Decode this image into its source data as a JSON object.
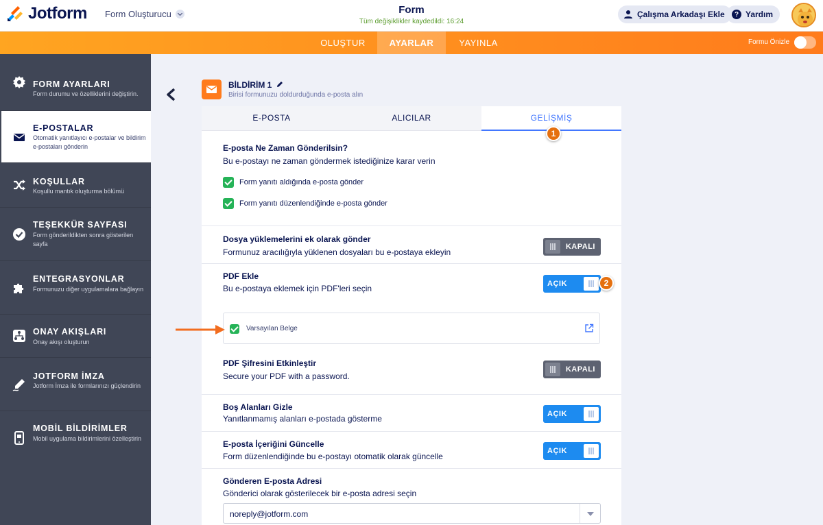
{
  "app": {
    "brand": "Jotform",
    "builder_label": "Form Oluşturucu",
    "form_title": "Form",
    "save_status": "Tüm değişiklikler kaydedildi: 16:24",
    "invite_label": "Çalışma Arkadaşı Ekle",
    "help_label": "Yardım"
  },
  "nav": {
    "tabs": [
      {
        "label": "OLUŞTUR"
      },
      {
        "label": "AYARLAR"
      },
      {
        "label": "YAYINLA"
      }
    ],
    "preview_label": "Formu Önizle"
  },
  "sidebar": {
    "items": [
      {
        "title": "FORM AYARLARI",
        "desc": "Form durumu ve özelliklerini değiştirin."
      },
      {
        "title": "E-POSTALAR",
        "desc": "Otomatik yanıtlayıcı e-postalar ve bildirim e-postaları gönderin"
      },
      {
        "title": "KOŞULLAR",
        "desc": "Koşullu mantık oluşturma bölümü"
      },
      {
        "title": "TEŞEKKÜR SAYFASI",
        "desc": "Form gönderildikten sonra gösterilen sayfa"
      },
      {
        "title": "ENTEGRASYONLAR",
        "desc": "Formunuzu diğer uygulamalara bağlayın"
      },
      {
        "title": "ONAY AKIŞLARI",
        "desc": "Onay akışı oluşturun"
      },
      {
        "title": "JOTFORM İMZA",
        "desc": "Jotform İmza ile formlarınızı güçlendirin"
      },
      {
        "title": "MOBİL BİLDİRİMLER",
        "desc": "Mobil uygulama bildirimlerini özelleştirin"
      }
    ]
  },
  "notification": {
    "title": "BİLDİRİM 1",
    "subtitle": "Birisi formunuzu doldurduğunda e-posta alın"
  },
  "tabs": [
    {
      "label": "E-POSTA"
    },
    {
      "label": "ALICILAR"
    },
    {
      "label": "GELİŞMİŞ"
    }
  ],
  "badges": {
    "one": "1",
    "two": "2"
  },
  "advanced": {
    "when": {
      "title": "E-posta Ne Zaman Gönderilsin?",
      "desc": "Bu e-postayı ne zaman göndermek istediğinize karar verin",
      "options": [
        {
          "label": "Form yanıtı aldığında e-posta gönder",
          "checked": true
        },
        {
          "label": "Form yanıtı düzenlendiğinde e-posta gönder",
          "checked": true
        }
      ]
    },
    "attachments": {
      "title": "Dosya yüklemelerini ek olarak gönder",
      "desc": "Formunuz aracılığıyla yüklenen dosyaları bu e-postaya ekleyin",
      "state": "KAPALI"
    },
    "pdf": {
      "title": "PDF Ekle",
      "desc": "Bu e-postaya eklemek için PDF'leri seçin",
      "state": "AÇIK",
      "document": "Varsayılan Belge"
    },
    "pdf_password": {
      "title": "PDF Şifresini Etkinleştir",
      "desc": "Secure your PDF with a password.",
      "state": "KAPALI"
    },
    "hide_empty": {
      "title": "Boş Alanları Gizle",
      "desc": "Yanıtlanmamış alanları e-postada gösterme",
      "state": "AÇIK"
    },
    "update_content": {
      "title": "E-posta İçeriğini Güncelle",
      "desc": "Form düzenlendiğinde bu e-postayı otomatik olarak güncelle",
      "state": "AÇIK"
    },
    "sender": {
      "title": "Gönderen E-posta Adresi",
      "desc": "Gönderici olarak gösterilecek bir e-posta adresi seçin",
      "value": "noreply@jotform.com"
    }
  },
  "colors": {
    "accent": "#ff7b1c",
    "toggle_on": "#1d8bf0",
    "toggle_off": "#5d6271",
    "check": "#25b357",
    "badge": "#e5700f"
  }
}
